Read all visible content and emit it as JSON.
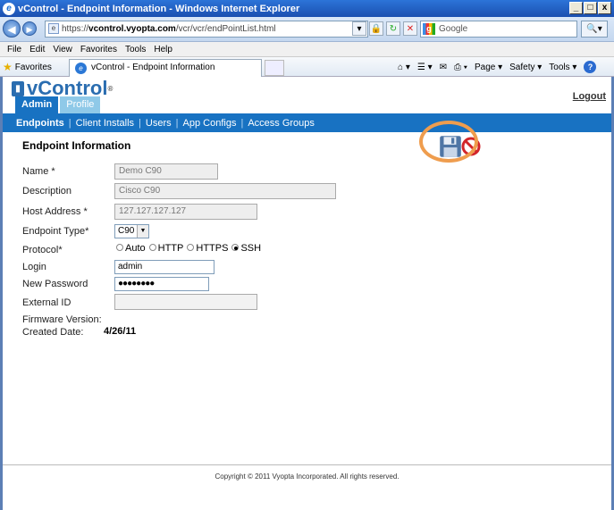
{
  "window": {
    "title": "vControl - Endpoint Information - Windows Internet Explorer",
    "min": "_",
    "max": "□",
    "close": "x"
  },
  "address": {
    "url_prefix": "https://",
    "url_host": "vcontrol.vyopta.com",
    "url_path": "/vcr/vcr/endPointList.html",
    "search_placeholder": "Google"
  },
  "menu": [
    "File",
    "Edit",
    "View",
    "Favorites",
    "Tools",
    "Help"
  ],
  "favorites": {
    "label": "Favorites",
    "tab_title": "vControl - Endpoint Information"
  },
  "commands": [
    "Page ▾",
    "Safety ▾",
    "Tools ▾"
  ],
  "app": {
    "logo": "vControl",
    "logout": "Logout",
    "tabs": [
      "Admin",
      "Profile"
    ]
  },
  "subnav": [
    "Endpoints",
    "Client Installs",
    "Users",
    "App Configs",
    "Access Groups"
  ],
  "form": {
    "title": "Endpoint Information",
    "labels": {
      "name": "Name *",
      "description": "Description",
      "host": "Host Address *",
      "type": "Endpoint Type*",
      "protocol": "Protocol*",
      "login": "Login",
      "password": "New Password",
      "external": "External ID",
      "firmware": "Firmware Version:",
      "created": "Created Date:"
    },
    "values": {
      "name": "Demo C90",
      "description": "Cisco C90",
      "host": "127.127.127.127",
      "type": "C90",
      "login": "admin",
      "password": "●●●●●●●●",
      "external": "",
      "created": "4/26/11"
    },
    "protocols": [
      "Auto",
      "HTTP",
      "HTTPS",
      "SSH"
    ],
    "selected_protocol": "SSH"
  },
  "footer": "Copyright © 2011 Vyopta Incorporated. All rights reserved.",
  "colors": {
    "accent": "#1872c2",
    "highlight_ring": "#ef9d4e"
  }
}
